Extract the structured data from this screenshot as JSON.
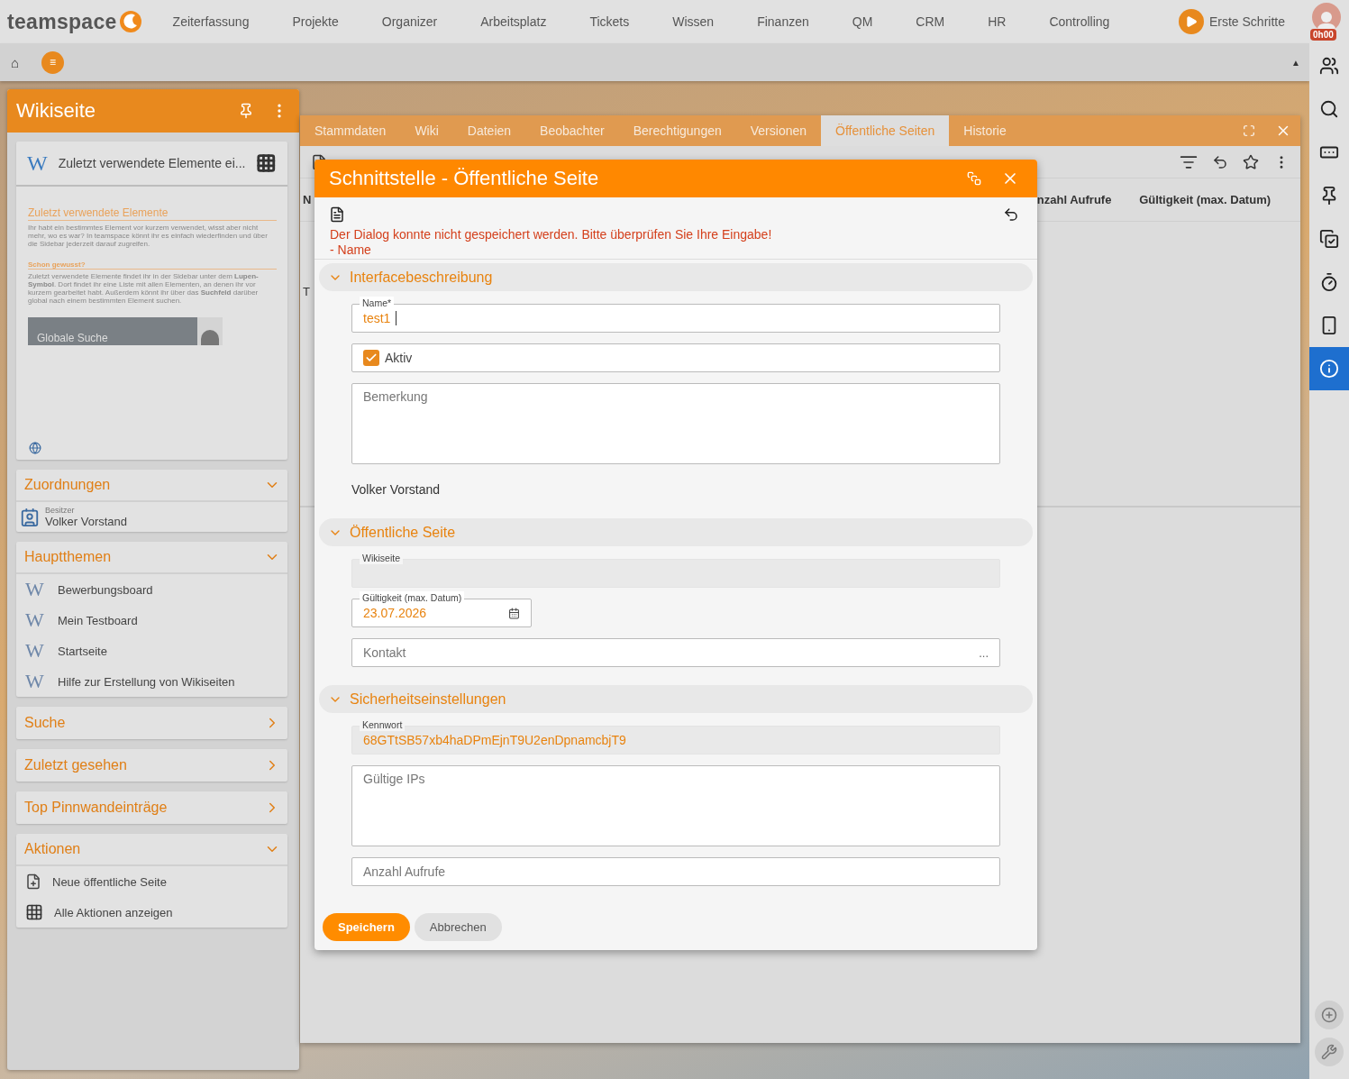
{
  "brand": {
    "name": "teamspace"
  },
  "nav": {
    "items": [
      "Zeiterfassung",
      "Projekte",
      "Organizer",
      "Arbeitsplatz",
      "Tickets",
      "Wissen",
      "Finanzen",
      "QM",
      "CRM",
      "HR",
      "Controlling"
    ],
    "tour": "Erste Schritte",
    "timer": "0h00"
  },
  "breadcrumb": {
    "home": "⌂",
    "menu": "≡",
    "collapse": "▲"
  },
  "rail": {
    "items": [
      {
        "selected": false
      },
      {
        "selected": false
      },
      {
        "selected": false
      },
      {
        "selected": false
      },
      {
        "selected": false
      },
      {
        "selected": false
      },
      {
        "selected": false
      },
      {
        "selected": true
      }
    ]
  },
  "sidebar": {
    "title": "Wikiseite",
    "preview": {
      "badge": "W",
      "title": "Zuletzt verwendete Elemente ei...",
      "heading": "Zuletzt verwendete Elemente",
      "intro": "Ihr habt ein bestimmtes Element vor kurzem verwendet, wisst aber nicht mehr, wo es war? In teamspace könnt ihr es einfach wiederfinden und über die Sidebar jederzeit darauf zugreifen.",
      "subheading": "Schon gewusst?",
      "tip": "Zuletzt verwendete Elemente findet ihr in der Sidebar unter dem **Lupen-Symbol**. Dort findet ihr eine Liste mit allen Elementen, an denen ihr vor kurzem gearbeitet habt. Außerdem könnt ihr über das **Suchfeld** darüber global nach einem bestimmten Element suchen.",
      "search_label": "Globale Suche"
    },
    "sections": [
      {
        "title": "Zuordnungen",
        "expanded": true,
        "items": [
          {
            "kind": "owner",
            "caption": "Besitzer",
            "label": "Volker Vorstand"
          }
        ]
      },
      {
        "title": "Hauptthemen",
        "expanded": true,
        "items": [
          {
            "kind": "wiki",
            "badge": "W",
            "label": "Bewerbungsboard"
          },
          {
            "kind": "wiki",
            "badge": "W",
            "label": "Mein Testboard"
          },
          {
            "kind": "wiki",
            "badge": "W",
            "label": "Startseite"
          },
          {
            "kind": "wiki",
            "badge": "W",
            "label": "Hilfe zur Erstellung von Wikiseiten"
          }
        ]
      },
      {
        "title": "Suche",
        "expanded": false
      },
      {
        "title": "Zuletzt gesehen",
        "expanded": false
      },
      {
        "title": "Top Pinnwandeinträge",
        "expanded": false
      },
      {
        "title": "Aktionen",
        "expanded": true,
        "items": [
          {
            "kind": "new",
            "label": "Neue öffentliche Seite"
          },
          {
            "kind": "all",
            "label": "Alle Aktionen anzeigen"
          }
        ]
      }
    ]
  },
  "window": {
    "tabs": [
      {
        "label": "Stammdaten",
        "selected": false
      },
      {
        "label": "Wiki",
        "selected": false
      },
      {
        "label": "Dateien",
        "selected": false
      },
      {
        "label": "Beobachter",
        "selected": false
      },
      {
        "label": "Berechtigungen",
        "selected": false
      },
      {
        "label": "Versionen",
        "selected": false
      },
      {
        "label": "Öffentliche Seiten",
        "selected": true
      },
      {
        "label": "Historie",
        "selected": false
      }
    ],
    "table": {
      "columns": [
        "N",
        "nzahl Aufrufe",
        "Gültigkeit (max. Datum)"
      ],
      "rows": [
        [
          "T"
        ]
      ]
    }
  },
  "dialog": {
    "title": "Schnittstelle - Öffentliche Seite",
    "errors": [
      "Der Dialog konnte nicht gespeichert werden. Bitte überprüfen Sie Ihre Eingabe!",
      "- Name"
    ],
    "sections": [
      {
        "title": "Interfacebeschreibung",
        "expanded": true,
        "fields": [
          {
            "kind": "text",
            "label": "Name*",
            "value": "test1",
            "focused": true
          },
          {
            "kind": "checkbox",
            "label": "Aktiv",
            "checked": true
          },
          {
            "kind": "textarea",
            "placeholder": "Bemerkung"
          },
          {
            "kind": "static",
            "value": "Volker Vorstand"
          }
        ]
      },
      {
        "title": "Öffentliche Seite",
        "expanded": true,
        "fields": [
          {
            "kind": "readonly",
            "label": "Wikiseite"
          },
          {
            "kind": "date",
            "label": "Gültigkeit (max. Datum)",
            "value": "23.07.2026"
          },
          {
            "kind": "lookup",
            "placeholder": "Kontakt",
            "button": "..."
          }
        ]
      },
      {
        "title": "Sicherheitseinstellungen",
        "expanded": true,
        "fields": [
          {
            "kind": "readonly",
            "label": "Kennwort",
            "value": "68GTtSB57xb4haDPmEjnT9U2enDpnamcbjT9"
          },
          {
            "kind": "textarea",
            "placeholder": "Gültige IPs"
          },
          {
            "kind": "text",
            "placeholder": "Anzahl Aufrufe"
          }
        ]
      }
    ],
    "buttons": [
      {
        "label": "Speichern",
        "primary": true
      },
      {
        "label": "Abbrechen",
        "primary": false
      }
    ]
  }
}
